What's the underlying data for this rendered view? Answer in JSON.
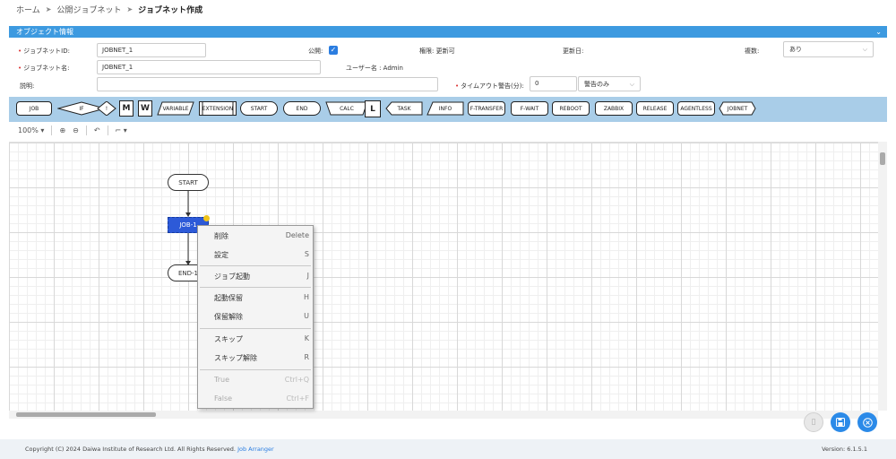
{
  "breadcrumb": {
    "home": "ホーム",
    "public": "公開ジョブネット",
    "current": "ジョブネット作成"
  },
  "object_info": {
    "header": "オブジェクト情報",
    "jobnet_id_label": "ジョブネットID:",
    "jobnet_id_value": "JOBNET_1",
    "jobnet_name_label": "ジョブネット名:",
    "jobnet_name_value": "JOBNET_1",
    "description_label": "説明:",
    "public_label": "公開:",
    "permission_text": "権限: 更新可",
    "updated_label": "更新日:",
    "user_text": "ユーザー名 : Admin",
    "multiplicity_label": "複数:",
    "multiplicity_value": "あり",
    "timeout_label": "タイムアウト警告(分):",
    "timeout_value": "0",
    "timeout_mode_value": "警告のみ"
  },
  "palette": {
    "job": "JOB",
    "if": "IF",
    "excl": "!",
    "m": "M",
    "w": "W",
    "variable": "VARIABLE",
    "extension": "EXTENSION",
    "start": "START",
    "end": "END",
    "calc": "CALC",
    "l": "L",
    "task": "TASK",
    "info": "INFO",
    "ftransfer": "F-TRANSFER",
    "fwait": "F-WAIT",
    "reboot": "REBOOT",
    "zabbix": "ZABBIX",
    "release": "RELEASE",
    "agentless": "AGENTLESS",
    "jobnet": "JOBNET"
  },
  "toolbar": {
    "zoom": "100%"
  },
  "canvas": {
    "start": "START",
    "job": "JOB-1",
    "end": "END-1"
  },
  "context_menu": [
    {
      "label": "削除",
      "key": "Delete"
    },
    {
      "label": "設定",
      "key": "S"
    },
    {
      "label": "ジョブ起動",
      "key": "J"
    },
    {
      "label": "起動保留",
      "key": "H"
    },
    {
      "label": "保留解除",
      "key": "U"
    },
    {
      "label": "スキップ",
      "key": "K"
    },
    {
      "label": "スキップ解除",
      "key": "R"
    },
    {
      "label": "True",
      "key": "Ctrl+Q"
    },
    {
      "label": "False",
      "key": "Ctrl+F"
    }
  ],
  "footer": {
    "copyright": "Copyright (C) 2024 Daiwa Institute of Research Ltd. All Rights Reserved.",
    "product": "Job Arranger",
    "version": "Version: 6.1.5.1"
  },
  "colors": {
    "accent": "#3d9ae0",
    "palette_bg": "#a9cde8",
    "selected_job": "#2d5ad8",
    "primary_button": "#2b8ae8"
  }
}
